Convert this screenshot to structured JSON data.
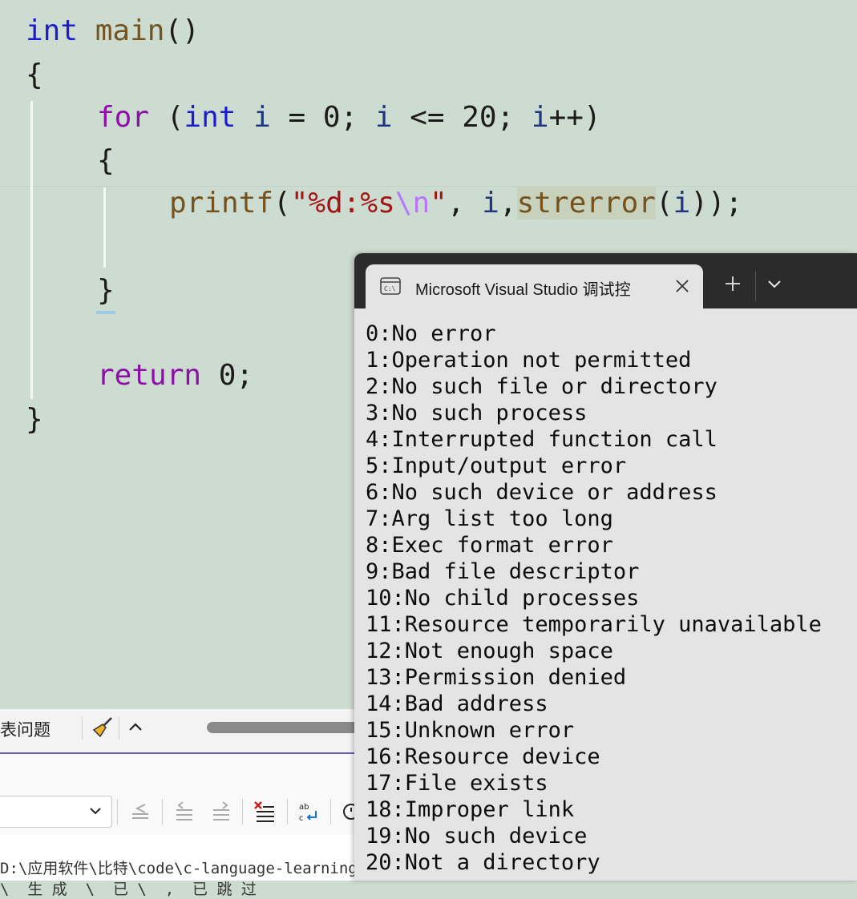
{
  "editor": {
    "lines": {
      "l1": {
        "t_int": "int",
        "t_main": "main",
        "t_paren": "()"
      },
      "l2": {
        "brace": "{"
      },
      "l3": {
        "t_for": "for",
        "t_open": " (",
        "t_int": "int",
        "t_i": "i",
        "t_eq": " = 0; ",
        "t_i2": "i",
        "t_le": " <= 20; ",
        "t_i3": "i",
        "t_pp": "++)"
      },
      "l4": {
        "brace": "{"
      },
      "l5": {
        "t_printf": "printf",
        "t_open": "(",
        "t_q1": "\"%d:%s",
        "t_esc": "\\n",
        "t_q2": "\"",
        "t_comma": ", ",
        "t_i": "i",
        "t_comma2": ",",
        "t_strerror": "strerror",
        "t_open2": "(",
        "t_i2": "i",
        "t_close": "));"
      },
      "l6": {
        "brace": "}"
      },
      "l7": {
        "t_return": "return",
        "t_zero": " 0;"
      },
      "l8": {
        "brace": "}"
      }
    }
  },
  "panel": {
    "tab_label": "表问题",
    "path_line_1": "D:\\应用软件\\比特\\code\\c-language-learning",
    "path_line_2": "\\  生 成  \\  已 \\  ,  已 跳 过"
  },
  "console": {
    "tab_title": "Microsoft Visual Studio 调试控",
    "new_tab_icon": "plus-icon",
    "menu_icon": "chevron-down-icon",
    "output": [
      "0:No error",
      "1:Operation not permitted",
      "2:No such file or directory",
      "3:No such process",
      "4:Interrupted function call",
      "5:Input/output error",
      "6:No such device or address",
      "7:Arg list too long",
      "8:Exec format error",
      "9:Bad file descriptor",
      "10:No child processes",
      "11:Resource temporarily unavailable",
      "12:Not enough space",
      "13:Permission denied",
      "14:Bad address",
      "15:Unknown error",
      "16:Resource device",
      "17:File exists",
      "18:Improper link",
      "19:No such device",
      "20:Not a directory"
    ]
  }
}
